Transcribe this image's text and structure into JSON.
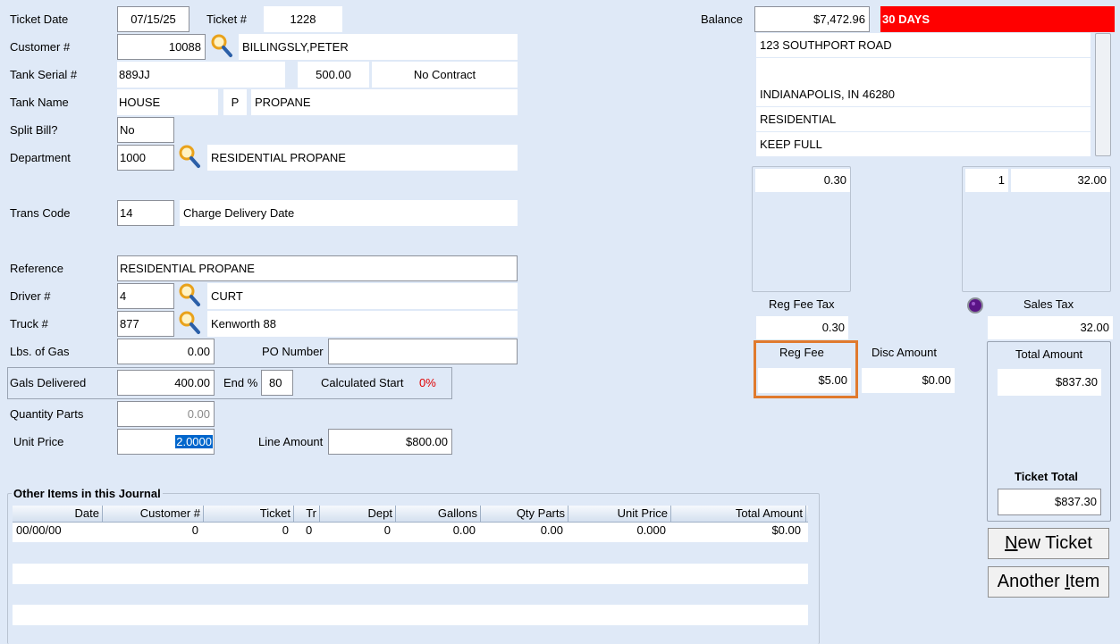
{
  "ticket": {
    "date_label": "Ticket Date",
    "date": "07/15/25",
    "number_label": "Ticket #",
    "number": "1228"
  },
  "customer": {
    "label": "Customer #",
    "number": "10088",
    "name": "BILLINGSLY,PETER"
  },
  "tank": {
    "serial_label": "Tank Serial #",
    "serial": "889JJ",
    "capacity": "500.00",
    "contract": "No Contract",
    "name_label": "Tank Name",
    "name": "HOUSE",
    "code": "P",
    "product": "PROPANE"
  },
  "split_bill": {
    "label": "Split Bill?",
    "value": "No"
  },
  "department": {
    "label": "Department",
    "code": "1000",
    "name": "RESIDENTIAL PROPANE"
  },
  "trans_code": {
    "label": "Trans Code",
    "code": "14",
    "description": "Charge Delivery Date"
  },
  "reference": {
    "label": "Reference",
    "value": "RESIDENTIAL PROPANE"
  },
  "driver": {
    "label": "Driver #",
    "number": "4",
    "name": "CURT"
  },
  "truck": {
    "label": "Truck #",
    "number": "877",
    "name": "Kenworth 88"
  },
  "lbs_gas": {
    "label": "Lbs. of Gas",
    "value": "0.00"
  },
  "po_number": {
    "label": "PO Number",
    "value": ""
  },
  "gals_delivered": {
    "label": "Gals Delivered",
    "value": "400.00"
  },
  "end_pct": {
    "label": "End %",
    "value": "80"
  },
  "calc_start": {
    "label": "Calculated Start",
    "value": "0%"
  },
  "quantity_parts": {
    "label": "Quantity Parts",
    "value": "0.00"
  },
  "unit_price": {
    "label": "Unit Price",
    "value": "2.0000"
  },
  "line_amount": {
    "label": "Line Amount",
    "value": "$800.00"
  },
  "account": {
    "balance_label": "Balance",
    "balance": "$7,472.96",
    "terms": "30 DAYS",
    "address_lines": [
      "123 SOUTHPORT ROAD",
      "",
      "INDIANAPOLIS, IN 46280",
      "RESIDENTIAL",
      "KEEP FULL"
    ]
  },
  "taxes": {
    "reg_fee_rate": "0.30",
    "sales_qty": "1",
    "sales_amount": "32.00",
    "reg_fee_tax_label": "Reg Fee Tax",
    "reg_fee_tax": "0.30",
    "sales_tax_label": "Sales Tax",
    "sales_tax": "32.00"
  },
  "fees": {
    "reg_fee_label": "Reg Fee",
    "reg_fee": "$5.00",
    "disc_amount_label": "Disc Amount",
    "disc_amount": "$0.00"
  },
  "totals": {
    "total_amount_label": "Total Amount",
    "total_amount": "$837.30",
    "ticket_total_label": "Ticket Total",
    "ticket_total": "$837.30"
  },
  "buttons": {
    "new_ticket": {
      "underlined": "N",
      "rest": "ew Ticket"
    },
    "another_item": {
      "before": "Another ",
      "underlined": "I",
      "after": "tem"
    }
  },
  "journal": {
    "title": "Other Items in this Journal",
    "columns": [
      "Date",
      "Customer #",
      "Ticket",
      "Tr",
      "Dept",
      "Gallons",
      "Qty Parts",
      "Unit Price",
      "Total Amount"
    ],
    "rows": [
      [
        "00/00/00",
        "0",
        "0",
        "0",
        "0",
        "0.00",
        "0.00",
        "0.000",
        "$0.00"
      ]
    ]
  },
  "colors": {
    "background": "#dfe9f7",
    "terms_bg": "#ff0000",
    "highlight_border": "#e07a2e",
    "selection": "#0066cc"
  },
  "icons": {
    "lookup": "magnifier-icon",
    "status": "purple-dot-icon"
  }
}
